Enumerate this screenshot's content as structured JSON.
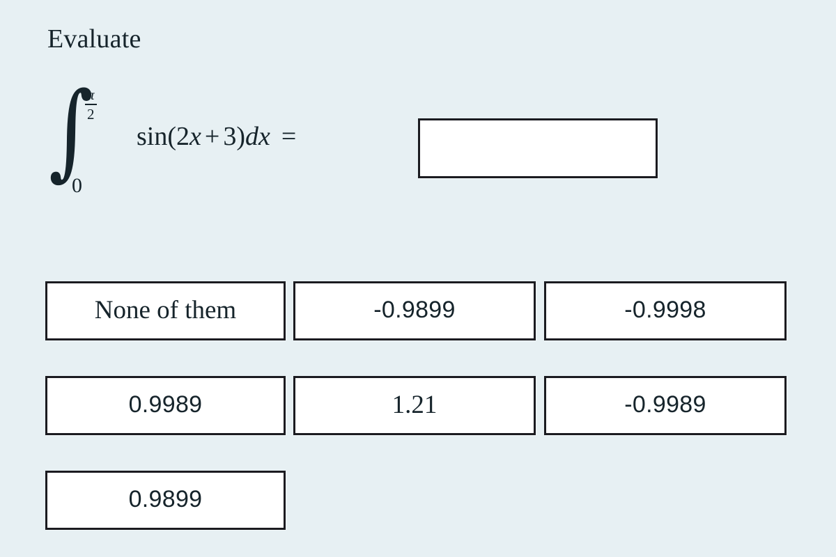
{
  "question": {
    "title": "Evaluate",
    "expression": {
      "integral_symbol": "∫",
      "lower_limit": "0",
      "upper_limit_numerator": "π",
      "upper_limit_denominator": "2",
      "function_name": "sin",
      "open_paren": "(",
      "coefficient": "2",
      "variable": "x",
      "plus": "+",
      "constant": "3",
      "close_paren": ")",
      "differential_d": "d",
      "differential_var": "x",
      "equals": "="
    }
  },
  "answer_input": {
    "value": "",
    "placeholder": ""
  },
  "options": [
    [
      {
        "label": "None of them",
        "style": "serif"
      },
      {
        "label": "-0.9899",
        "style": "sans"
      },
      {
        "label": "-0.9998",
        "style": "sans"
      }
    ],
    [
      {
        "label": "0.9989",
        "style": "sans"
      },
      {
        "label": "1.21",
        "style": "serif"
      },
      {
        "label": "-0.9989",
        "style": "sans"
      }
    ],
    [
      {
        "label": "0.9899",
        "style": "sans"
      }
    ]
  ],
  "colors": {
    "background": "#e7f0f3",
    "text": "#16242b",
    "box_border": "#1b1b20",
    "box_fill": "#ffffff"
  }
}
